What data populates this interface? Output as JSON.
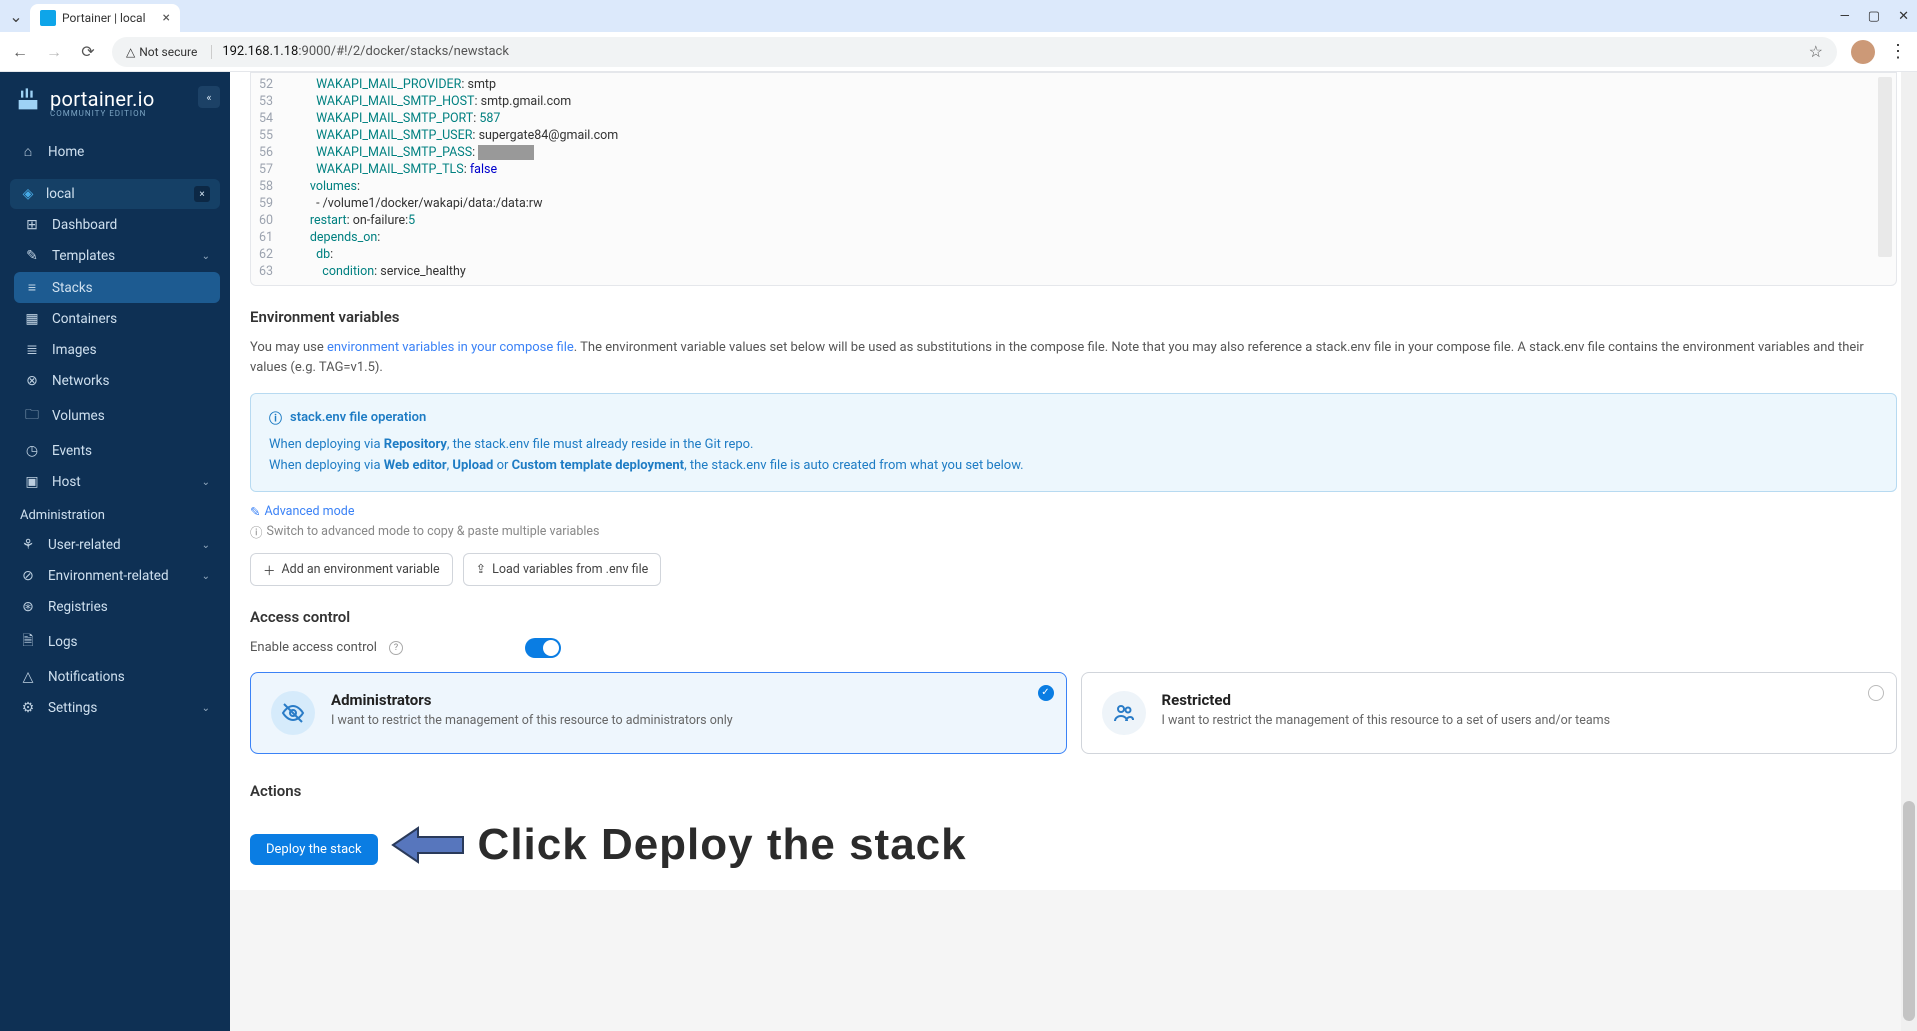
{
  "browser": {
    "tab_title": "Portainer | local",
    "insecure_label": "Not secure",
    "url_host": "192.168.1.18",
    "url_path": ":9000/#!/2/docker/stacks/newstack",
    "window_min": "—",
    "window_max": "▢",
    "window_close": "✕"
  },
  "sidebar": {
    "logo": "portainer.io",
    "edition": "COMMUNITY EDITION",
    "home": "Home",
    "env_name": "local",
    "items": [
      {
        "icon": "⊞",
        "label": "Dashboard"
      },
      {
        "icon": "✎",
        "label": "Templates",
        "chevron": true
      },
      {
        "icon": "≡",
        "label": "Stacks",
        "active": true
      },
      {
        "icon": "▦",
        "label": "Containers"
      },
      {
        "icon": "≣",
        "label": "Images"
      },
      {
        "icon": "⊗",
        "label": "Networks"
      },
      {
        "icon": "🗀",
        "label": "Volumes"
      },
      {
        "icon": "◷",
        "label": "Events"
      },
      {
        "icon": "▣",
        "label": "Host",
        "chevron": true
      }
    ],
    "admin_label": "Administration",
    "admin_items": [
      {
        "icon": "⚘",
        "label": "User-related",
        "chevron": true
      },
      {
        "icon": "⊘",
        "label": "Environment-related",
        "chevron": true
      },
      {
        "icon": "⊛",
        "label": "Registries"
      },
      {
        "icon": "🗎",
        "label": "Logs"
      },
      {
        "icon": "△",
        "label": "Notifications"
      },
      {
        "icon": "⚙",
        "label": "Settings",
        "chevron": true
      }
    ]
  },
  "editor": {
    "lines": [
      {
        "n": 52,
        "indent": "          ",
        "key": "WAKAPI_MAIL_PROVIDER",
        "val": "smtp"
      },
      {
        "n": 53,
        "indent": "          ",
        "key": "WAKAPI_MAIL_SMTP_HOST",
        "val": "smtp.gmail.com"
      },
      {
        "n": 54,
        "indent": "          ",
        "key": "WAKAPI_MAIL_SMTP_PORT",
        "val": "587",
        "num": true
      },
      {
        "n": 55,
        "indent": "          ",
        "key": "WAKAPI_MAIL_SMTP_USER",
        "val": "supergate84@gmail.com"
      },
      {
        "n": 56,
        "indent": "          ",
        "key": "WAKAPI_MAIL_SMTP_PASS",
        "val": "                  ",
        "redact": true
      },
      {
        "n": 57,
        "indent": "          ",
        "key": "WAKAPI_MAIL_SMTP_TLS",
        "val": "false",
        "kw": true
      },
      {
        "n": 58,
        "indent": "        ",
        "key": "volumes",
        "val": ""
      },
      {
        "n": 59,
        "indent": "          ",
        "raw": "- /volume1/docker/wakapi/data:/data:rw"
      },
      {
        "n": 60,
        "indent": "        ",
        "key": "restart",
        "val": "on-failure:",
        "tail": "5"
      },
      {
        "n": 61,
        "indent": "        ",
        "key": "depends_on",
        "val": ""
      },
      {
        "n": 62,
        "indent": "          ",
        "key": "db",
        "val": ""
      },
      {
        "n": 63,
        "indent": "            ",
        "key": "condition",
        "val": "service_healthy"
      }
    ]
  },
  "env": {
    "title": "Environment variables",
    "desc_pre": "You may use ",
    "desc_link": "environment variables in your compose file",
    "desc_post": ". The environment variable values set below will be used as substitutions in the compose file. Note that you may also reference a stack.env file in your compose file. A stack.env file contains the environment variables and their values (e.g. TAG=v1.5).",
    "info_title": "stack.env file operation",
    "info_l1a": "When deploying via ",
    "info_l1b": "Repository",
    "info_l1c": ", the stack.env file must already reside in the Git repo.",
    "info_l2a": "When deploying via ",
    "info_l2b": "Web editor",
    "info_l2c": ", ",
    "info_l2d": "Upload",
    "info_l2e": " or ",
    "info_l2f": "Custom template deployment",
    "info_l2g": ", the stack.env file is auto created from what you set below.",
    "adv_mode": "Advanced mode",
    "adv_hint": "Switch to advanced mode to copy & paste multiple variables",
    "btn_add": "Add an environment variable",
    "btn_load": "Load variables from .env file"
  },
  "access": {
    "title": "Access control",
    "enable_label": "Enable access control",
    "admin_title": "Administrators",
    "admin_desc": "I want to restrict the management of this resource to administrators only",
    "restr_title": "Restricted",
    "restr_desc": "I want to restrict the management of this resource to a set of users and/or teams"
  },
  "actions": {
    "title": "Actions",
    "deploy": "Deploy the stack",
    "annotation": "Click Deploy the stack"
  }
}
